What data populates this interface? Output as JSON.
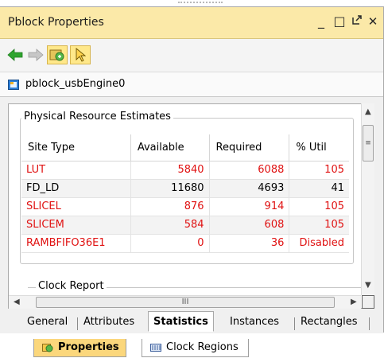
{
  "window": {
    "title": "Pblock Properties",
    "controls": [
      "minimize",
      "maximize",
      "float",
      "close"
    ]
  },
  "toolbar": {
    "back": "back-arrow-icon",
    "forward": "forward-arrow-icon",
    "auto_update": "auto-update-icon",
    "select": "select-cursor-icon"
  },
  "object_name": "pblock_usbEngine0",
  "statistics": {
    "group_title": "Physical Resource Estimates",
    "columns": [
      "Site Type",
      "Available",
      "Required",
      "% Util"
    ],
    "rows": [
      {
        "site_type": "LUT",
        "available": "5840",
        "required": "6088",
        "util": "105",
        "overused": true
      },
      {
        "site_type": "FD_LD",
        "available": "11680",
        "required": "4693",
        "util": "41",
        "overused": false
      },
      {
        "site_type": "SLICEL",
        "available": "876",
        "required": "914",
        "util": "105",
        "overused": true
      },
      {
        "site_type": "SLICEM",
        "available": "584",
        "required": "608",
        "util": "105",
        "overused": true
      },
      {
        "site_type": "RAMBFIFO36E1",
        "available": "0",
        "required": "36",
        "util": "Disabled",
        "overused": true
      }
    ],
    "clock_group_title": "Clock Report"
  },
  "scrollbar": {
    "grip": "≡",
    "hgrip": "III"
  },
  "tabs": [
    "General",
    "Attributes",
    "Statistics",
    "Instances",
    "Rectangles"
  ],
  "selected_tab": "Statistics",
  "bottom_tabs": [
    "Properties",
    "Clock Regions"
  ],
  "colors": {
    "overused": "#e01212",
    "titlebar": "#fbe9a8",
    "selected_bottom_tab": "#fbd77c"
  }
}
